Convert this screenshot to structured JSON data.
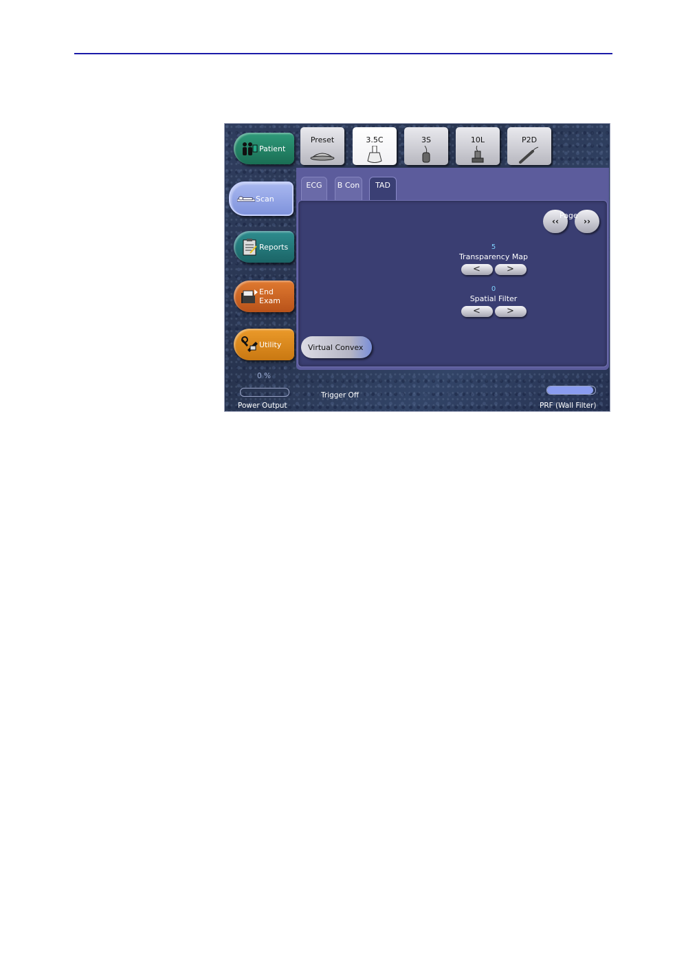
{
  "nav": {
    "patient": "Patient",
    "scan": "Scan",
    "reports": "Reports",
    "end_exam_line1": "End",
    "end_exam_line2": "Exam",
    "utility": "Utility"
  },
  "probes": [
    {
      "label": "Preset",
      "icon": "preset-icon",
      "active": false
    },
    {
      "label": "3.5C",
      "icon": "convex-probe-icon",
      "active": true
    },
    {
      "label": "3S",
      "icon": "sector-probe-icon",
      "active": false
    },
    {
      "label": "10L",
      "icon": "linear-probe-icon",
      "active": false
    },
    {
      "label": "P2D",
      "icon": "pencil-probe-icon",
      "active": false
    }
  ],
  "tabs": [
    {
      "label": "ECG",
      "active": false
    },
    {
      "label": "B Con",
      "active": false
    },
    {
      "label": "TAD",
      "active": true
    }
  ],
  "pager": {
    "label": "Page",
    "prev": "‹‹",
    "next": "››"
  },
  "controls": {
    "transparency_map": {
      "value": "5",
      "label": "Transparency Map",
      "left": "<",
      "right": ">"
    },
    "spatial_filter": {
      "value": "0",
      "label": "Spatial Filter",
      "left": "<",
      "right": ">"
    }
  },
  "virtual_convex": "Virtual Convex",
  "footer": {
    "power_value": "0 %",
    "power_label": "Power Output",
    "power_level": 0,
    "trigger": "Trigger Off",
    "prf_label": "PRF (Wall Filter)",
    "prf_level": 0.95
  },
  "colors": {
    "rule": "#1a1aa8",
    "panel": "#3a3e72",
    "accent_value": "#7fd4ff"
  }
}
